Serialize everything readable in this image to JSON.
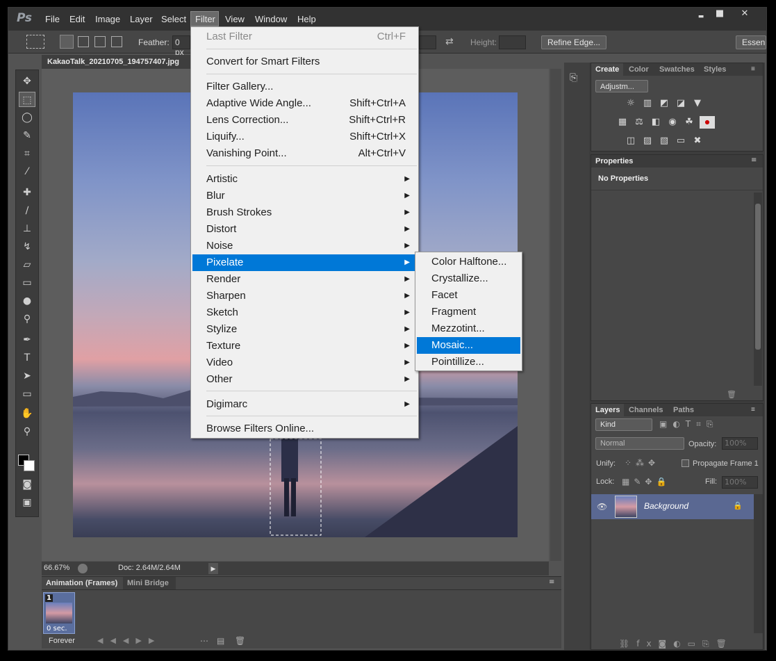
{
  "app": {
    "logo": "Ps"
  },
  "menubar": {
    "items": [
      "File",
      "Edit",
      "Image",
      "Layer",
      "Select",
      "Filter",
      "View",
      "Window",
      "Help"
    ],
    "active": "Filter"
  },
  "window_controls": {
    "minimize": "▬",
    "maximize": "■",
    "close": "✕"
  },
  "options": {
    "feather_label": "Feather:",
    "feather_value": "0 px",
    "height_label": "Height:",
    "refine_edge": "Refine Edge...",
    "workspace": "Essen"
  },
  "document": {
    "tab_title": "KakaoTalk_20210705_194757407.jpg",
    "zoom": "66.67%",
    "doc_info": "Doc: 2.64M/2.64M"
  },
  "filter_menu": {
    "last_filter": {
      "label": "Last Filter",
      "shortcut": "Ctrl+F"
    },
    "convert_smart": "Convert for Smart Filters",
    "gallery": "Filter Gallery...",
    "adaptive": {
      "label": "Adaptive Wide Angle...",
      "shortcut": "Shift+Ctrl+A"
    },
    "lens": {
      "label": "Lens Correction...",
      "shortcut": "Shift+Ctrl+R"
    },
    "liquify": {
      "label": "Liquify...",
      "shortcut": "Shift+Ctrl+X"
    },
    "vanishing": {
      "label": "Vanishing Point...",
      "shortcut": "Alt+Ctrl+V"
    },
    "submenus": [
      "Artistic",
      "Blur",
      "Brush Strokes",
      "Distort",
      "Noise",
      "Pixelate",
      "Render",
      "Sharpen",
      "Sketch",
      "Stylize",
      "Texture",
      "Video",
      "Other"
    ],
    "digimarc": "Digimarc",
    "browse": "Browse Filters Online..."
  },
  "pixelate_menu": {
    "items": [
      "Color Halftone...",
      "Crystallize...",
      "Facet",
      "Fragment",
      "Mezzotint...",
      "Mosaic...",
      "Pointillize..."
    ],
    "selected": "Mosaic..."
  },
  "adjust_panel": {
    "tabs": [
      "Create",
      "Color",
      "Swatches",
      "Styles"
    ],
    "dropdown": "Adjustm..."
  },
  "properties_panel": {
    "title": "Properties",
    "empty_text": "No Properties"
  },
  "layers_panel": {
    "tabs": [
      "Layers",
      "Channels",
      "Paths"
    ],
    "kind": "Kind",
    "blend": "Normal",
    "opacity_label": "Opacity:",
    "opacity_value": "100%",
    "unify_label": "Unify:",
    "propagate": "Propagate Frame 1",
    "lock_label": "Lock:",
    "fill_label": "Fill:",
    "fill_value": "100%",
    "layer_name": "Background"
  },
  "animation_panel": {
    "tabs": [
      "Animation (Frames)",
      "Mini Bridge"
    ],
    "frame_number": "1",
    "frame_delay": "0 sec.",
    "loop": "Forever"
  }
}
